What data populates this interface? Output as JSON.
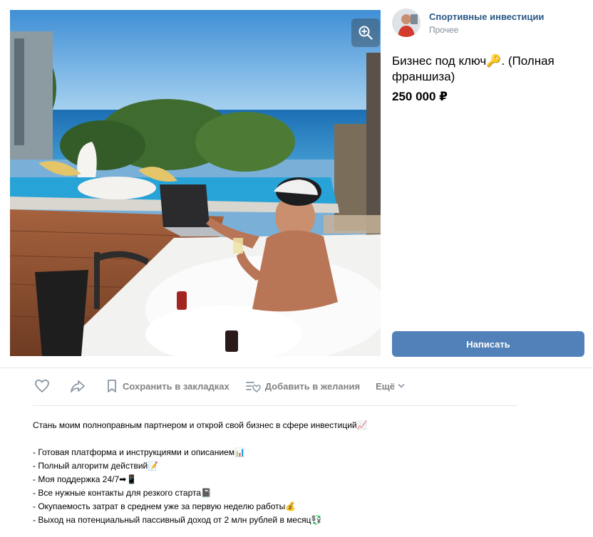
{
  "photo": {
    "alt_icons": [
      "zoom-in-icon"
    ]
  },
  "seller": {
    "name": "Спортивные инвестиции",
    "category": "Прочее"
  },
  "product": {
    "title": "Бизнес под ключ🔑. (Полная франшиза)",
    "price": "250 000 ₽"
  },
  "buttons": {
    "write": "Написать"
  },
  "actions": {
    "like_icon": "heart-icon",
    "share_icon": "share-arrow-icon",
    "bookmark_label": "Сохранить в закладках",
    "wishlist_label": "Добавить в желания",
    "more_label": "Ещё"
  },
  "description": {
    "intro": "Стань моим полноправным партнером и открой свой бизнес в сфере инвестиций📈",
    "bullets": [
      "- Готовая платформа и инструкциями и описанием📊",
      "- Полный алгоритм действий📝",
      "- Моя поддержка 24/7➡📱",
      "- Все нужные контакты для резкого старта📓",
      "- Окупаемость затрат в среднем уже за первую неделю работы💰",
      "- Выход на потенциальный пассивный доход от 2 млн рублей в месяц💱"
    ]
  },
  "colors": {
    "link": "#2a5885",
    "button": "#5181b8",
    "muted": "#828282",
    "divider": "#e7e8ec"
  }
}
